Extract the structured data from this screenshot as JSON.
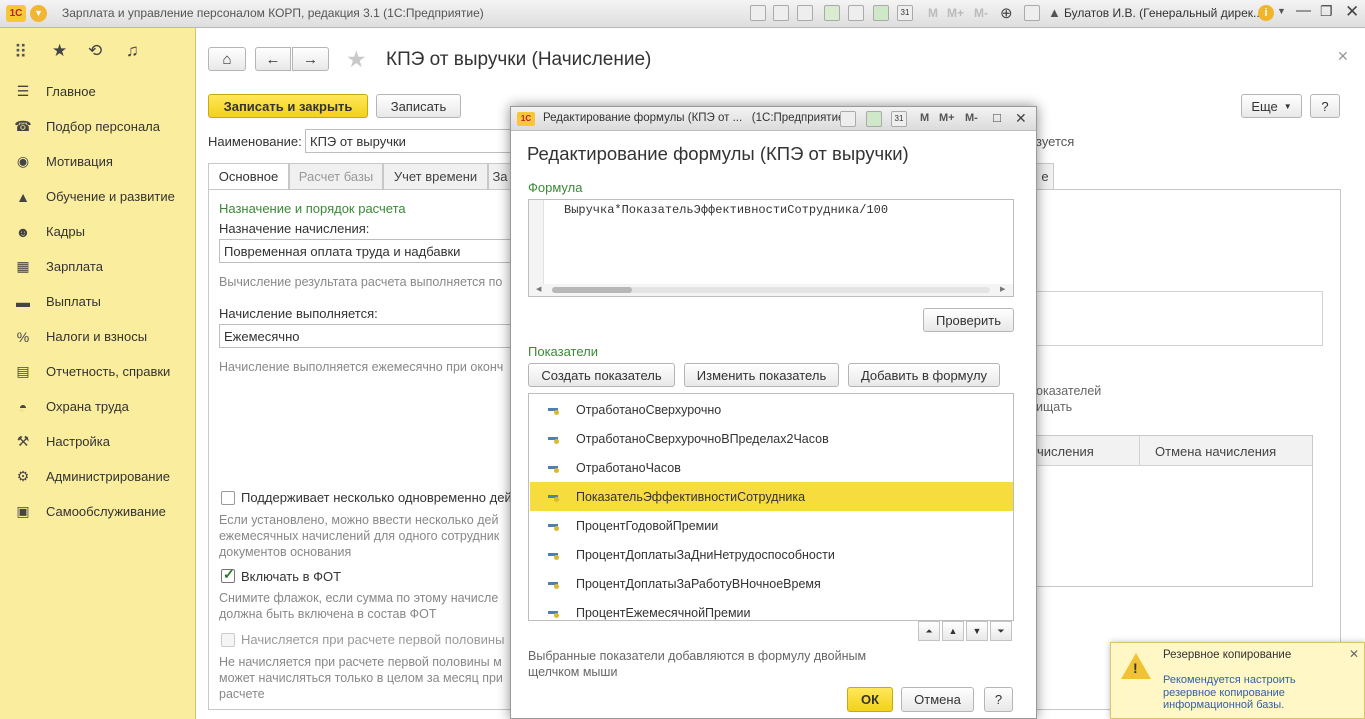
{
  "window": {
    "title": "Зарплата и управление персоналом КОРП, редакция 3.1",
    "platform": "(1С:Предприятие)",
    "user": "Булатов И.В. (Генеральный дирек...",
    "m_buttons": [
      "M",
      "M+",
      "M-"
    ]
  },
  "sidebar": {
    "items": [
      {
        "label": "Главное",
        "icon": "menu-icon"
      },
      {
        "label": "Подбор персонала",
        "icon": "headset-icon"
      },
      {
        "label": "Мотивация",
        "icon": "coins-icon"
      },
      {
        "label": "Обучение и развитие",
        "icon": "graduation-cap-icon"
      },
      {
        "label": "Кадры",
        "icon": "people-icon"
      },
      {
        "label": "Зарплата",
        "icon": "calculator-icon"
      },
      {
        "label": "Выплаты",
        "icon": "wallet-icon"
      },
      {
        "label": "Налоги и взносы",
        "icon": "percent-icon"
      },
      {
        "label": "Отчетность, справки",
        "icon": "report-icon"
      },
      {
        "label": "Охрана труда",
        "icon": "helmet-icon"
      },
      {
        "label": "Настройка",
        "icon": "wrench-icon"
      },
      {
        "label": "Администрирование",
        "icon": "gear-icon"
      },
      {
        "label": "Самообслуживание",
        "icon": "self-service-icon"
      }
    ]
  },
  "form": {
    "title": "КПЭ от выручки (Начисление)",
    "save_close_label": "Записать и закрыть",
    "save_label": "Записать",
    "more_label": "Еще",
    "help_label": "?",
    "name_label": "Наименование:",
    "name_value": "КПЭ от выручки",
    "right_hint": "зуется",
    "tabs": [
      "Основное",
      "Расчет базы",
      "Учет времени",
      "За",
      "е"
    ],
    "section_title": "Назначение и порядок расчета",
    "purpose_label": "Назначение начисления:",
    "purpose_value": "Повременная оплата труда и надбавки",
    "calc_hint": "Вычисление результата расчета выполняется по",
    "performed_label": "Начисление выполняется:",
    "performed_value": "Ежемесячно",
    "performed_hint": "Начисление выполняется ежемесячно при оконч",
    "multi_label": "Поддерживает несколько одновременно дей",
    "multi_hint": [
      "Если установлено, можно ввести несколько дей",
      "ежемесячных начислений для одного сотрудник",
      "документов основания"
    ],
    "fot_label": "Включать в ФОТ",
    "fot_hint": [
      "Снимите флажок, если сумма по этому начисле",
      "должна быть включена в состав ФОТ"
    ],
    "first_half_label": "Начисляется при расчете первой половины",
    "first_half_hint": [
      "Не начисляется при расчете первой половины м",
      "может начисляться только в целом за месяц при",
      "расчете"
    ],
    "right_text": [
      "оказателей",
      "ищать"
    ],
    "table_headers": [
      "числения",
      "Отмена начисления"
    ]
  },
  "dialog": {
    "window_title": "Редактирование формулы (КПЭ от ...",
    "window_platform": "(1С:Предприятие)",
    "heading": "Редактирование формулы (КПЭ от выручки)",
    "formula_label": "Формула",
    "formula_value": "Выручка*ПоказательЭффективностиСотрудника/100",
    "check_button": "Проверить",
    "indicators_label": "Показатели",
    "create_button": "Создать показатель",
    "edit_button": "Изменить показатель",
    "add_button": "Добавить в формулу",
    "indicators": [
      "ОтработаноСверхурочно",
      "ОтработаноСверхурочноВПределах2Часов",
      "ОтработаноЧасов",
      "ПоказательЭффективностиСотрудника",
      "ПроцентГодовойПремии",
      "ПроцентДоплатыЗаДниНетрудоспособности",
      "ПроцентДоплатыЗаРаботуВНочноеВремя",
      "ПроцентЕжемесячнойПремии"
    ],
    "selected_index": 3,
    "footer_hint": [
      "Выбранные показатели добавляются в формулу двойным",
      "щелчком мыши"
    ],
    "ok_label": "ОК",
    "cancel_label": "Отмена",
    "help_label": "?",
    "m_buttons": [
      "M",
      "M+",
      "M-"
    ]
  },
  "notification": {
    "title": "Резервное копирование",
    "body": [
      "Рекомендуется настроить",
      "резервное копирование",
      "информационной базы."
    ]
  },
  "colors": {
    "sidebar_bg": "#fbed9e",
    "primary_button": "#f5d91f",
    "selected_row": "#f7dc3e",
    "section_green": "#3a8a35",
    "link_blue": "#2f62a8"
  }
}
